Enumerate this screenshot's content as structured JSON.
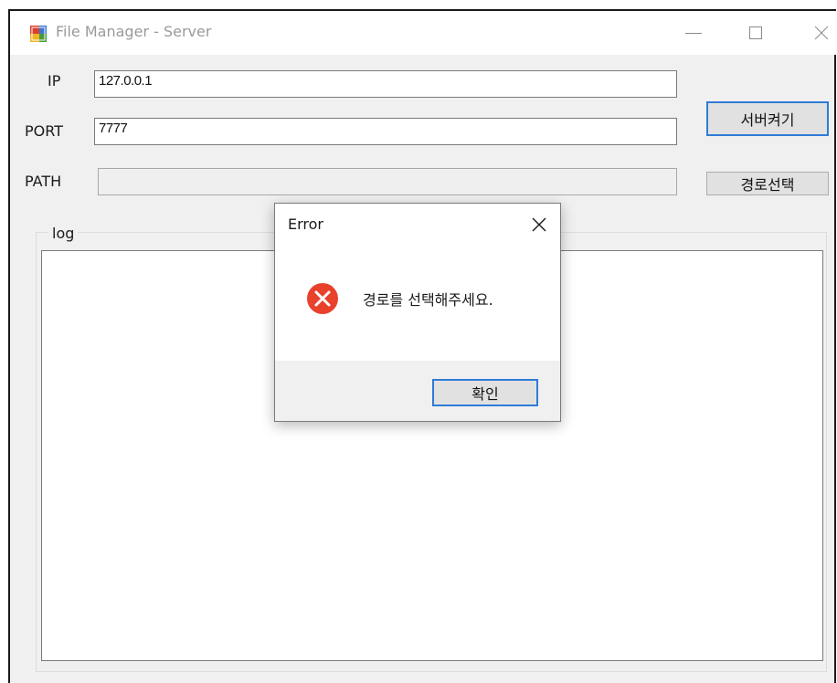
{
  "window": {
    "title": "File Manager - Server",
    "icons": {
      "app": "winforms-app-icon",
      "minimize": "minimize-icon",
      "maximize": "maximize-icon",
      "close": "close-icon"
    }
  },
  "form": {
    "ip_label": "IP",
    "ip_value": "127.0.0.1",
    "port_label": "PORT",
    "port_value": "7777",
    "path_label": "PATH",
    "path_value": "",
    "start_server_button": "서버켜기",
    "select_path_button": "경로선택",
    "log_group_label": "log"
  },
  "dialog": {
    "title": "Error",
    "icon": "error-icon",
    "message": "경로를 선택해주세요.",
    "ok_button": "확인"
  },
  "colors": {
    "error_red": "#e8412c",
    "focus_blue": "#2f7bd6",
    "window_bg": "#f0f0f0"
  }
}
